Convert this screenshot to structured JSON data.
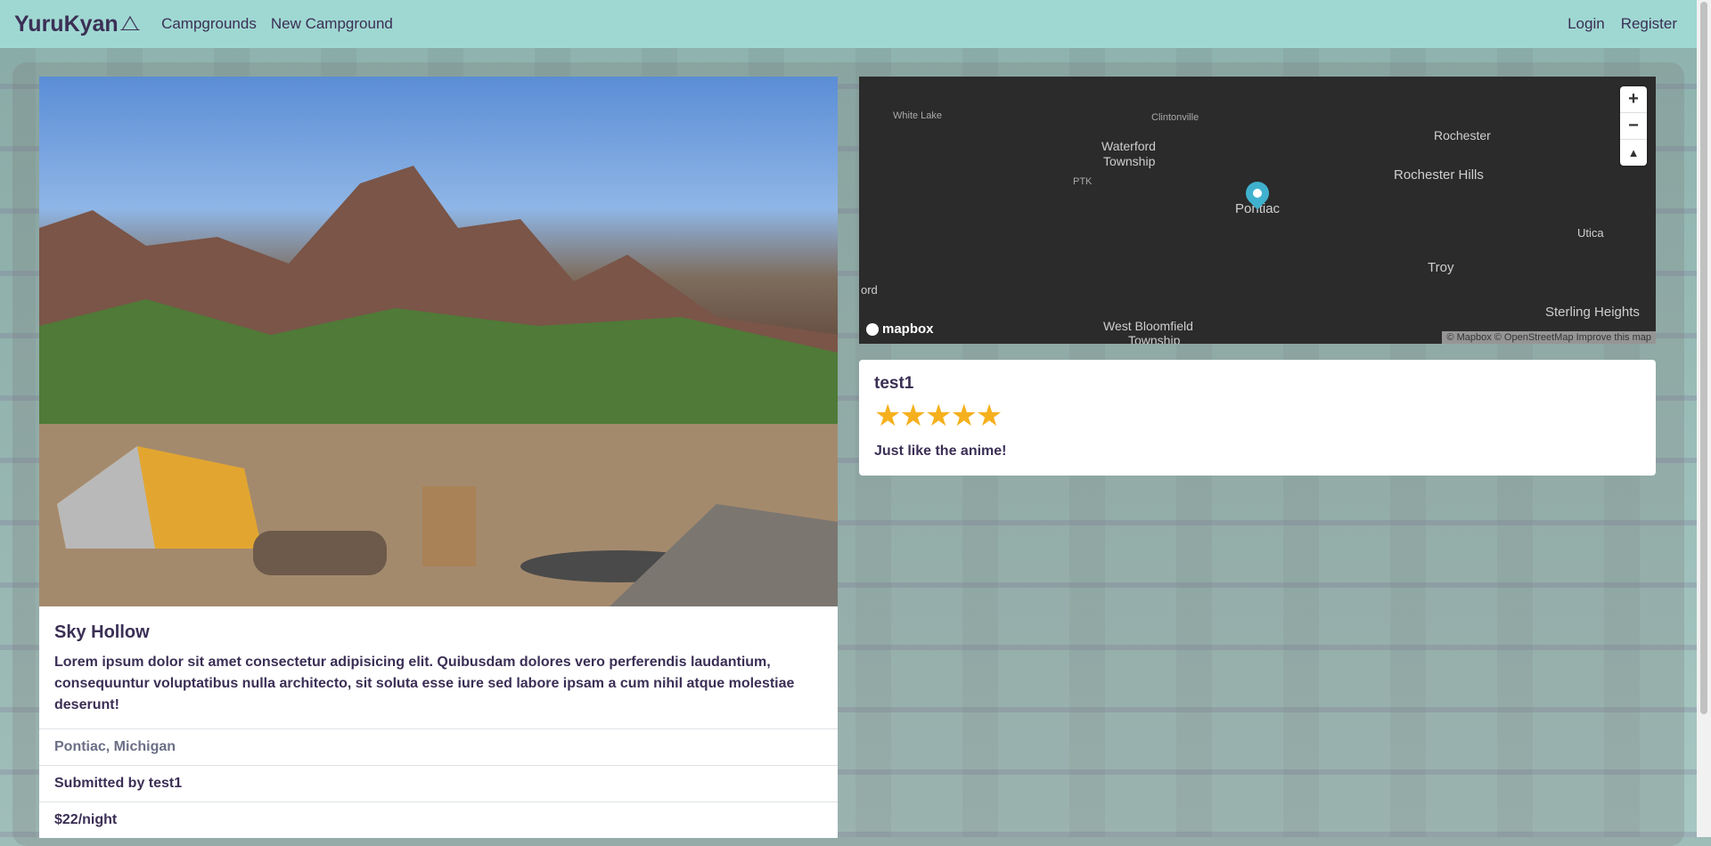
{
  "navbar": {
    "brand": "YuruKyan",
    "brand_icon": "tent-icon",
    "links": [
      "Campgrounds",
      "New Campground"
    ],
    "auth_links": [
      "Login",
      "Register"
    ]
  },
  "campground": {
    "title": "Sky Hollow",
    "description": "Lorem ipsum dolor sit amet consectetur adipisicing elit. Quibusdam dolores vero perferendis laudantium, consequuntur voluptatibus nulla architecto, sit soluta esse iure sed labore ipsam a cum nihil atque molestiae deserunt!",
    "location": "Pontiac, Michigan",
    "submitted_by": "Submitted by test1",
    "price": "$22/night"
  },
  "map": {
    "labels": {
      "white_lake": "White Lake",
      "clintonville": "Clintonville",
      "waterford": "Waterford",
      "township": "Township",
      "ptk": "PTK",
      "rochester": "Rochester",
      "rochester_hills": "Rochester Hills",
      "pontiac": "Pontiac",
      "utica": "Utica",
      "troy": "Troy",
      "ord": "ord",
      "west_bloomfield": "West Bloomfield",
      "township2": "Township",
      "sterling_heights": "Sterling Heights"
    },
    "logo": "mapbox",
    "attribution": "© Mapbox © OpenStreetMap Improve this map",
    "zoom_in": "+",
    "zoom_out": "−",
    "compass": "▲"
  },
  "review": {
    "author": "test1",
    "rating_stars": "★★★★★",
    "rating": 5,
    "body": "Just like the anime!"
  }
}
